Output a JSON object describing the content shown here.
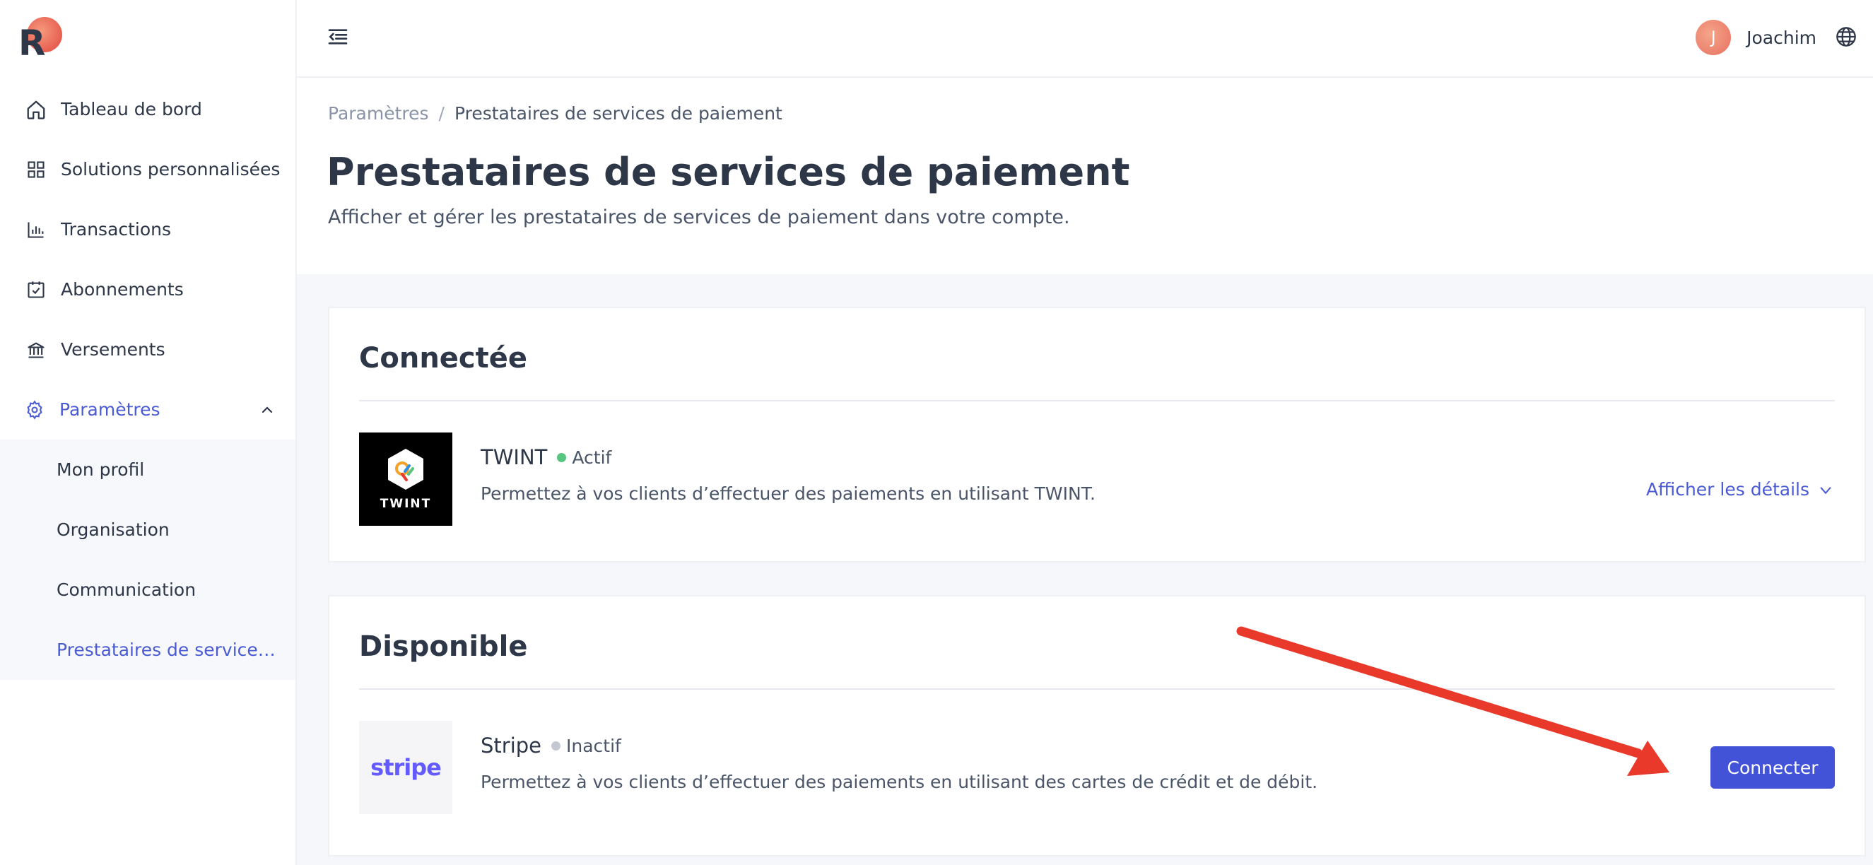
{
  "brand": {
    "logo_letter": "R"
  },
  "sidebar": {
    "items": [
      {
        "label": "Tableau de bord",
        "icon": "home-icon"
      },
      {
        "label": "Solutions personnalisées",
        "icon": "grid-icon"
      },
      {
        "label": "Transactions",
        "icon": "bar-chart-icon"
      },
      {
        "label": "Abonnements",
        "icon": "calendar-check-icon"
      },
      {
        "label": "Versements",
        "icon": "bank-icon"
      },
      {
        "label": "Paramètres",
        "icon": "gear-icon"
      }
    ],
    "sub_items": [
      {
        "label": "Mon profil"
      },
      {
        "label": "Organisation"
      },
      {
        "label": "Communication"
      },
      {
        "label": "Prestataires de services de paiement"
      }
    ]
  },
  "header": {
    "user": {
      "initial": "J",
      "name": "Joachim"
    }
  },
  "page": {
    "breadcrumb": {
      "parent": "Paramètres",
      "separator": "/",
      "current": "Prestataires de services de paiement"
    },
    "title": "Prestataires de services de paiement",
    "subtitle": "Afficher et gérer les prestataires de services de paiement dans votre compte."
  },
  "connected": {
    "title": "Connectée",
    "provider": {
      "name": "TWINT",
      "logo_text": "TWINT",
      "status": "Actif",
      "status_color": "#57c47f",
      "description": "Permettez à vos clients d’effectuer des paiements en utilisant TWINT.",
      "details_label": "Afficher les détails"
    }
  },
  "available": {
    "title": "Disponible",
    "provider": {
      "name": "Stripe",
      "logo_text": "stripe",
      "status": "Inactif",
      "status_color": "#c4c8d0",
      "description": "Permettez à vos clients d’effectuer des paiements en utilisant des cartes de crédit et de débit.",
      "connect_label": "Connecter"
    }
  },
  "colors": {
    "accent": "#4b5bd4",
    "button": "#4353d8",
    "annotation_arrow": "#e8392b"
  }
}
